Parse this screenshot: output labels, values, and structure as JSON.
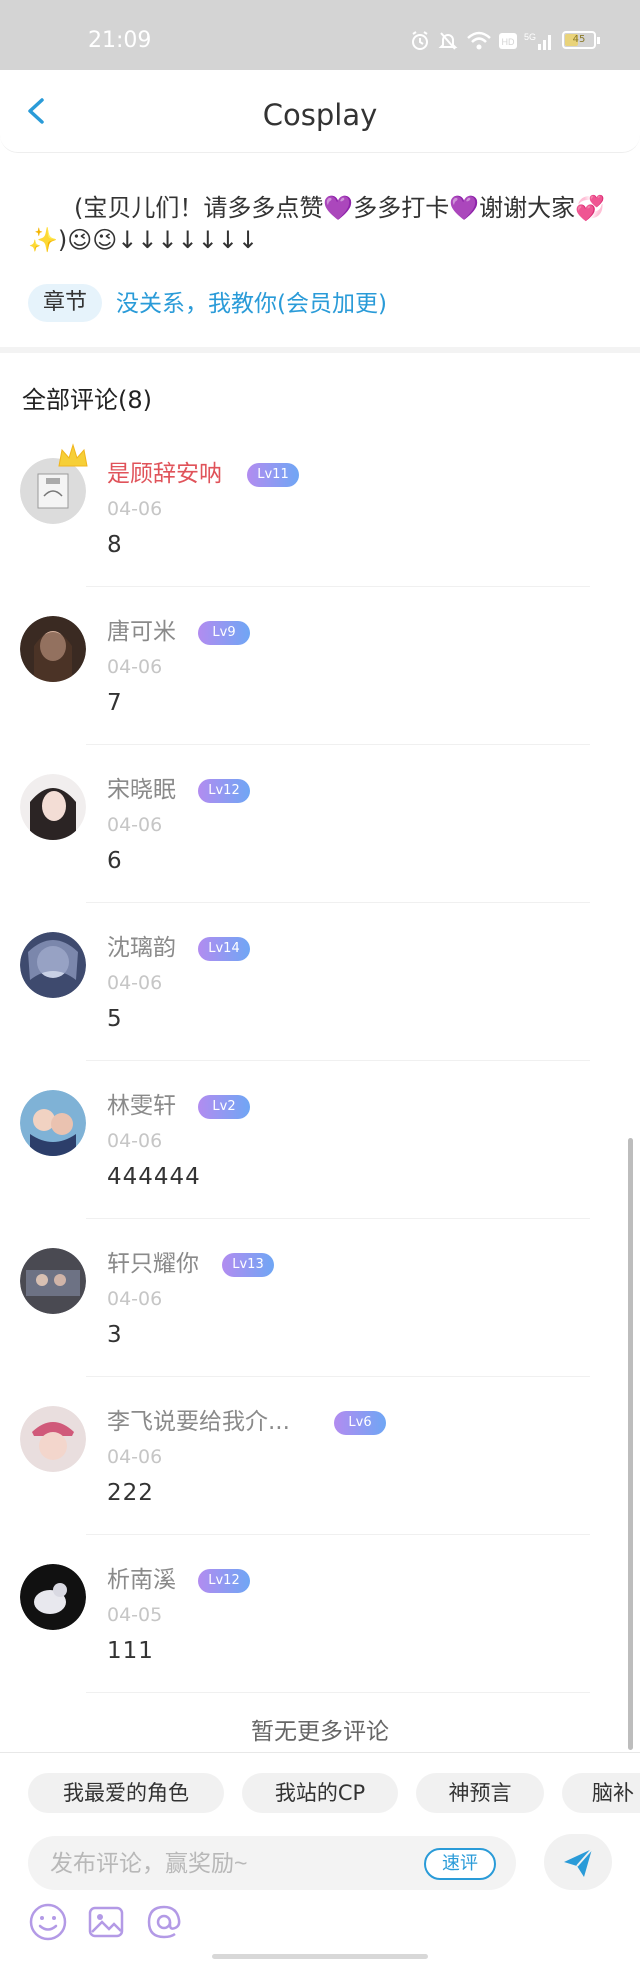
{
  "status_bar": {
    "time": "21:09",
    "battery": "45",
    "battery_level": 0.45
  },
  "nav": {
    "title": "Cosplay"
  },
  "intro": {
    "text": "(宝贝儿们！请多多点赞💜多多打卡💜谢谢大家💞✨)😉😉↓↓↓↓↓↓↓",
    "chapter_tag": "章节",
    "chapter_title": "没关系，我教你(会员加更)"
  },
  "comments_header": "全部评论(8)",
  "comments": [
    {
      "name": "是顾辞安呐",
      "level": "Lv11",
      "date": "04-06",
      "text": "8",
      "highlight": true
    },
    {
      "name": "唐可米",
      "level": "Lv9",
      "date": "04-06",
      "text": "7"
    },
    {
      "name": "宋晓眠",
      "level": "Lv12",
      "date": "04-06",
      "text": "6"
    },
    {
      "name": "沈璃韵",
      "level": "Lv14",
      "date": "04-06",
      "text": "5"
    },
    {
      "name": "林雯轩",
      "level": "Lv2",
      "date": "04-06",
      "text": "444444"
    },
    {
      "name": "轩只耀你",
      "level": "Lv13",
      "date": "04-06",
      "text": "3"
    },
    {
      "name": "李飞说要给我介...",
      "level": "Lv6",
      "date": "04-06",
      "text": "222"
    },
    {
      "name": "析南溪",
      "level": "Lv12",
      "date": "04-05",
      "text": "111"
    }
  ],
  "no_more": "暂无更多评论",
  "topic_chips": [
    "我最爱的角色",
    "我站的CP",
    "神预言",
    "脑补"
  ],
  "input": {
    "placeholder": "发布评论，赢奖励~",
    "quick_review": "速评"
  },
  "colors": {
    "accent": "#2a9bd8",
    "highlight_name": "#e0535a",
    "level_badge": "#9b93f2"
  },
  "icons": [
    "back-icon",
    "alarm-icon",
    "mute-icon",
    "wifi-icon",
    "hd-icon",
    "signal-icon",
    "battery-icon",
    "crown-icon",
    "send-icon",
    "emoji-icon",
    "image-icon",
    "mention-icon"
  ]
}
